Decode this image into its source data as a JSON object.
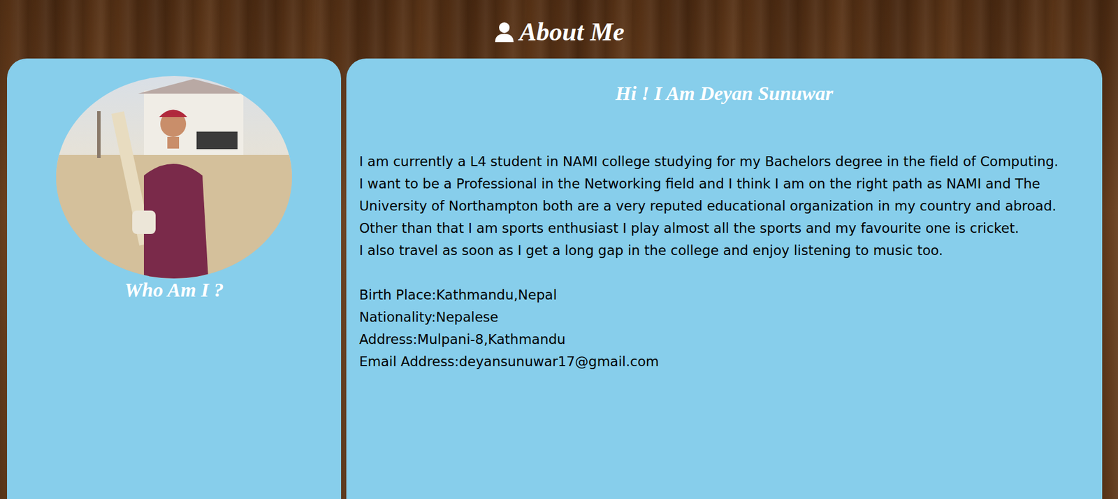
{
  "heading": {
    "title": "About Me"
  },
  "profile": {
    "caption": "Who Am I ?"
  },
  "intro": {
    "title": "Hi ! I Am Deyan Sunuwar",
    "paragraphs": [
      "I am currently a L4 student in NAMI college studying for my Bachelors degree in the field of Computing.",
      "I want to be a Professional in the Networking field and I think I am on the right path as NAMI and The University of Northampton both are a very reputed educational organization in my country and abroad.",
      "Other than that I am sports enthusiast I play almost all the sports and my favourite one is cricket.",
      "I also travel as soon as I get a long gap in the college and enjoy listening to music too."
    ],
    "details": [
      "Birth Place:Kathmandu,Nepal",
      "Nationality:Nepalese",
      "Address:Mulpani-8,Kathmandu",
      "Email Address:deyansunuwar17@gmail.com"
    ]
  }
}
